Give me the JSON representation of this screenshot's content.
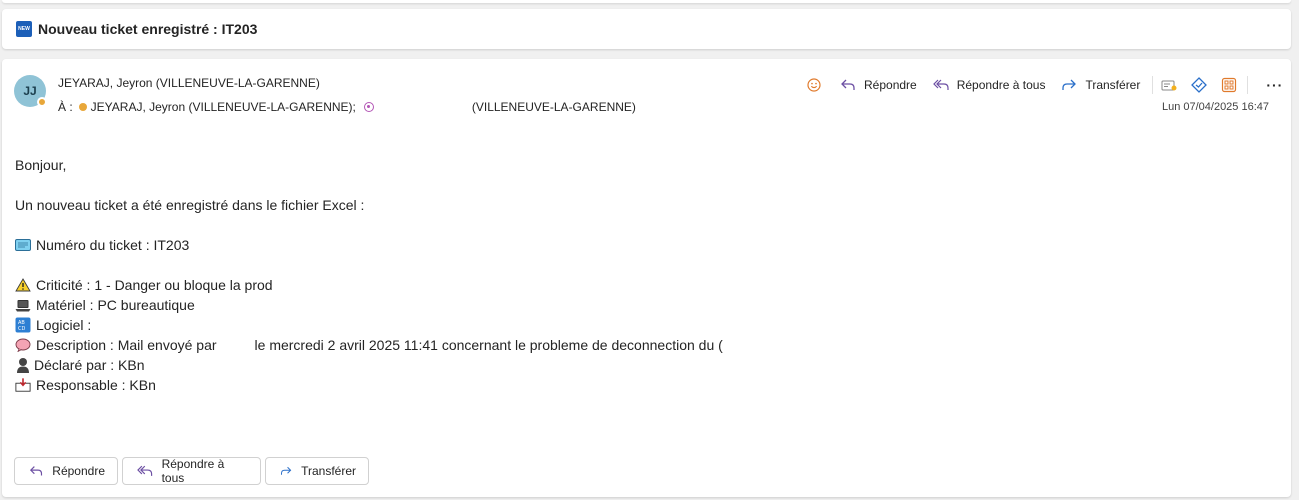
{
  "subject": {
    "icon": "new-badge-icon",
    "icon_text": "NEW",
    "title": "Nouveau ticket enregistré : IT203"
  },
  "header": {
    "avatar_initials": "JJ",
    "sender": "JEYARAJ, Jeyron (VILLENEUVE-LA-GARENNE)",
    "to_label": "À :",
    "recipient1": "JEYARAJ, Jeyron (VILLENEUVE-LA-GARENNE);",
    "recipient2": "(VILLENEUVE-LA-GARENNE)",
    "timestamp": "Lun 07/04/2025 16:47"
  },
  "actions": {
    "reply": "Répondre",
    "reply_all": "Répondre à tous",
    "forward": "Transférer"
  },
  "body": {
    "greeting": "Bonjour,",
    "intro": "Un nouveau ticket a été enregistré dans le fichier Excel :",
    "ticket_number": "Numéro du ticket : IT203",
    "criticite": "Criticité : 1 - Danger ou bloque la prod",
    "materiel": "Matériel : PC bureautique",
    "logiciel": "Logiciel :",
    "description_label": "Description : Mail envoyé par",
    "description_rest": "le mercredi 2 avril 2025 11:41 concernant le probleme de deconnection du (",
    "declare_par": "Déclaré par : KBn",
    "responsable": "Responsable : KBn"
  },
  "bottom_actions": {
    "reply": "Répondre",
    "reply_all": "Répondre à tous",
    "forward": "Transférer"
  },
  "colors": {
    "accent_reply": "#6c4fa3",
    "accent_forward": "#2a6fc9",
    "smiley": "#e07a2c",
    "presence_away": "#e8a73a",
    "presence_dnd": "#b355b5"
  }
}
